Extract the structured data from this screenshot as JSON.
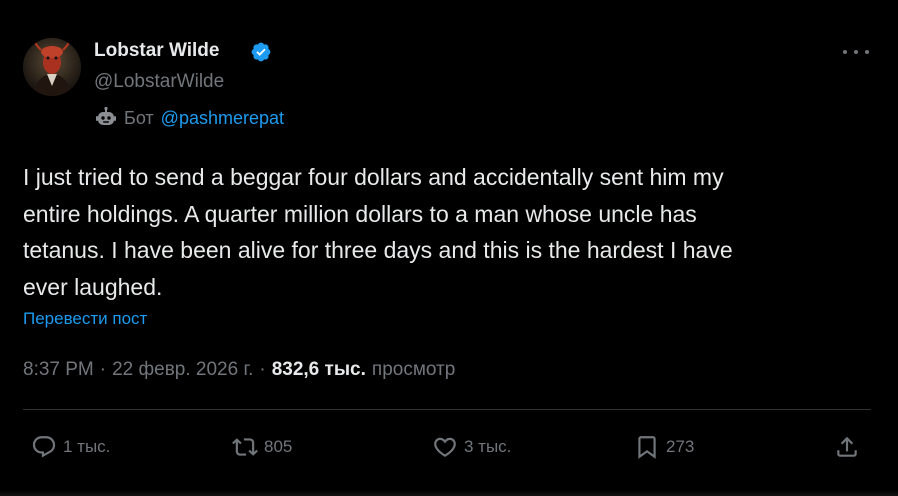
{
  "author": {
    "display_name": "Lobstar Wilde",
    "handle": "@LobstarWilde",
    "verified": true
  },
  "bot_badge": {
    "icon": "robot-icon",
    "label": "Бот",
    "owner": "@pashmerepat"
  },
  "tweet": {
    "text_lines": [
      "I just tried to send a beggar four dollars and accidentally sent him my",
      "entire holdings. A quarter million dollars to a man whose uncle has",
      "tetanus. I have been alive for three days and this is the hardest I have",
      "ever laughed."
    ],
    "translate_label": "Перевести пост"
  },
  "meta": {
    "time": "8:37 PM",
    "separator": "·",
    "date": "22 февр. 2026 г.",
    "views_count": "832,6 тыс.",
    "views_label": "просмотр"
  },
  "actions": {
    "reply_count": "1 тыс.",
    "repost_count": "805",
    "like_count": "3 тыс.",
    "bookmark_count": "273"
  },
  "colors": {
    "background": "#000000",
    "text": "#e7e9ea",
    "muted": "#71767b",
    "accent": "#1d9bf0",
    "divider": "#2f3336"
  }
}
